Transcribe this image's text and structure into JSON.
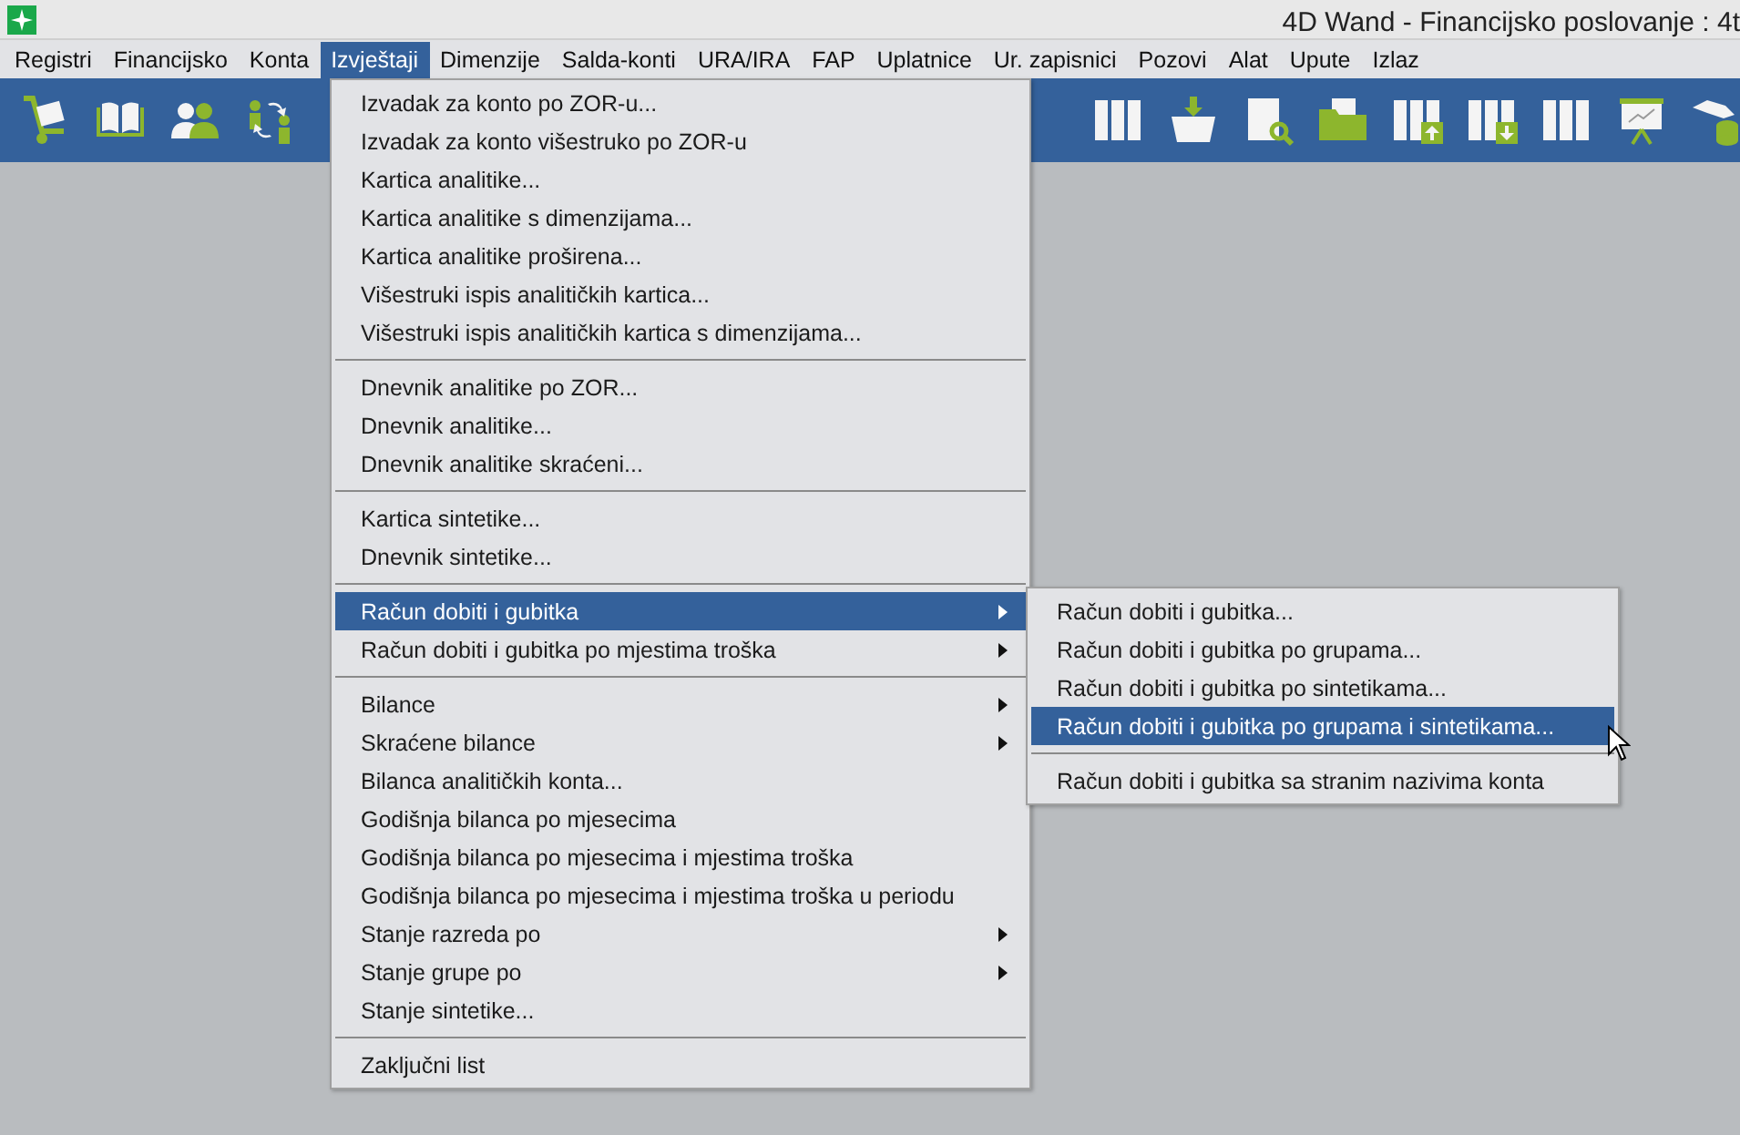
{
  "window": {
    "title": "4D Wand - Financijsko poslovanje : 4t"
  },
  "menu_bar": [
    {
      "label": "Registri",
      "selected": false
    },
    {
      "label": "Financijsko",
      "selected": false
    },
    {
      "label": "Konta",
      "selected": false
    },
    {
      "label": "Izvještaji",
      "selected": true
    },
    {
      "label": "Dimenzije",
      "selected": false
    },
    {
      "label": "Salda-konti",
      "selected": false
    },
    {
      "label": "URA/IRA",
      "selected": false
    },
    {
      "label": "FAP",
      "selected": false
    },
    {
      "label": "Uplatnice",
      "selected": false
    },
    {
      "label": "Ur. zapisnici",
      "selected": false
    },
    {
      "label": "Pozovi",
      "selected": false
    },
    {
      "label": "Alat",
      "selected": false
    },
    {
      "label": "Upute",
      "selected": false
    },
    {
      "label": "Izlaz",
      "selected": false
    }
  ],
  "dropdown": {
    "items": [
      {
        "kind": "item",
        "label": "Izvadak za konto po ZOR-u...",
        "selected": false,
        "has_submenu": false
      },
      {
        "kind": "item",
        "label": "Izvadak za konto višestruko po ZOR-u",
        "selected": false,
        "has_submenu": false
      },
      {
        "kind": "item",
        "label": "Kartica analitike...",
        "selected": false,
        "has_submenu": false
      },
      {
        "kind": "item",
        "label": "Kartica analitike s dimenzijama...",
        "selected": false,
        "has_submenu": false
      },
      {
        "kind": "item",
        "label": "Kartica analitike proširena...",
        "selected": false,
        "has_submenu": false
      },
      {
        "kind": "item",
        "label": "Višestruki ispis analitičkih kartica...",
        "selected": false,
        "has_submenu": false
      },
      {
        "kind": "item",
        "label": "Višestruki ispis analitičkih kartica s dimenzijama...",
        "selected": false,
        "has_submenu": false
      },
      {
        "kind": "separator"
      },
      {
        "kind": "item",
        "label": "Dnevnik analitike po ZOR...",
        "selected": false,
        "has_submenu": false
      },
      {
        "kind": "item",
        "label": "Dnevnik analitike...",
        "selected": false,
        "has_submenu": false
      },
      {
        "kind": "item",
        "label": "Dnevnik analitike skraćeni...",
        "selected": false,
        "has_submenu": false
      },
      {
        "kind": "separator"
      },
      {
        "kind": "item",
        "label": "Kartica sintetike...",
        "selected": false,
        "has_submenu": false
      },
      {
        "kind": "item",
        "label": "Dnevnik sintetike...",
        "selected": false,
        "has_submenu": false
      },
      {
        "kind": "separator"
      },
      {
        "kind": "item",
        "label": "Račun dobiti i gubitka",
        "selected": true,
        "has_submenu": true
      },
      {
        "kind": "item",
        "label": "Račun dobiti i gubitka po mjestima troška",
        "selected": false,
        "has_submenu": true
      },
      {
        "kind": "separator"
      },
      {
        "kind": "item",
        "label": "Bilance",
        "selected": false,
        "has_submenu": true
      },
      {
        "kind": "item",
        "label": "Skraćene bilance",
        "selected": false,
        "has_submenu": true
      },
      {
        "kind": "item",
        "label": "Bilanca analitičkih konta...",
        "selected": false,
        "has_submenu": false
      },
      {
        "kind": "item",
        "label": "Godišnja bilanca po mjesecima",
        "selected": false,
        "has_submenu": false
      },
      {
        "kind": "item",
        "label": "Godišnja bilanca po mjesecima i mjestima troška",
        "selected": false,
        "has_submenu": false
      },
      {
        "kind": "item",
        "label": "Godišnja bilanca po mjesecima i mjestima troška u periodu",
        "selected": false,
        "has_submenu": false
      },
      {
        "kind": "item",
        "label": "Stanje razreda po",
        "selected": false,
        "has_submenu": true
      },
      {
        "kind": "item",
        "label": "Stanje grupe po",
        "selected": false,
        "has_submenu": true
      },
      {
        "kind": "item",
        "label": "Stanje sintetike...",
        "selected": false,
        "has_submenu": false
      },
      {
        "kind": "separator"
      },
      {
        "kind": "item",
        "label": "Zaključni list",
        "selected": false,
        "has_submenu": false
      }
    ]
  },
  "submenu": {
    "items": [
      {
        "kind": "item",
        "label": "Račun dobiti i gubitka...",
        "selected": false,
        "has_submenu": false
      },
      {
        "kind": "item",
        "label": "Račun dobiti i gubitka po grupama...",
        "selected": false,
        "has_submenu": false
      },
      {
        "kind": "item",
        "label": "Račun dobiti i gubitka po sintetikama...",
        "selected": false,
        "has_submenu": false
      },
      {
        "kind": "item",
        "label": "Račun dobiti i gubitka po grupama i sintetikama...",
        "selected": true,
        "has_submenu": false
      },
      {
        "kind": "separator"
      },
      {
        "kind": "item",
        "label": "Račun dobiti i gubitka sa stranim nazivima konta",
        "selected": false,
        "has_submenu": false
      }
    ]
  }
}
